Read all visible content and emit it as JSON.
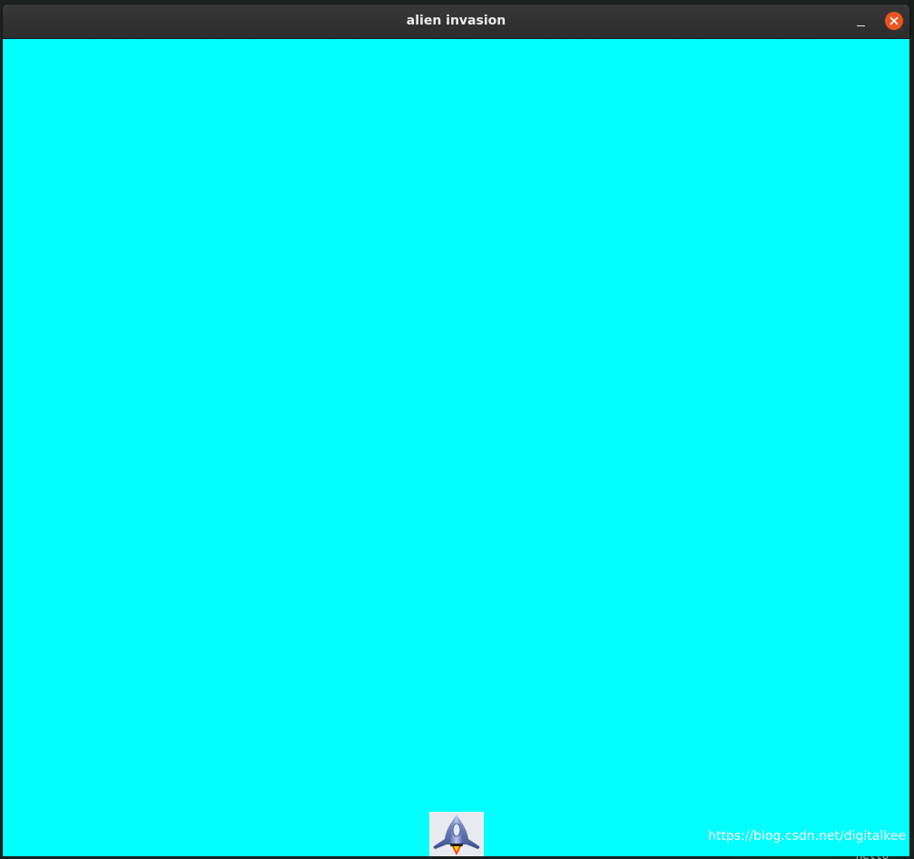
{
  "window": {
    "title": "alien invasion"
  },
  "game": {
    "background_color": "#00ffff",
    "ship_icon": "rocket-ship-icon"
  },
  "overlay": {
    "watermark": "https://blog.csdn.net/digitalkee"
  },
  "desktop": {
    "terminal_fragment": "Hello"
  },
  "colors": {
    "titlebar": "#2f2f2f",
    "close_button": "#e95420",
    "game_background": "#00ffff"
  }
}
